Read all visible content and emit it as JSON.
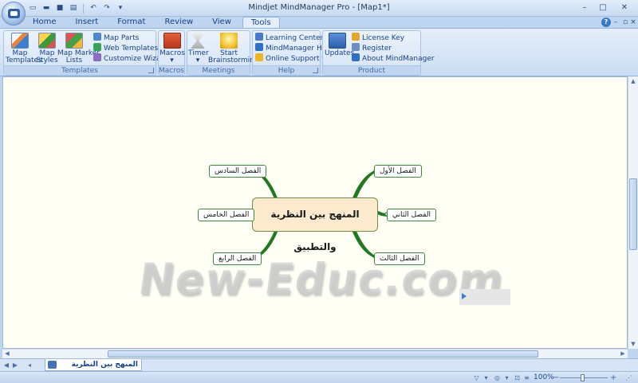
{
  "window": {
    "title": "Mindjet MindManager Pro - [Map1*]",
    "minimize": "–",
    "maximize": "□",
    "close": "✕"
  },
  "quick_access": [
    "new",
    "open",
    "save",
    "print",
    "undo",
    "redo"
  ],
  "tabs": [
    "Home",
    "Insert",
    "Format",
    "Review",
    "View",
    "Tools"
  ],
  "active_tab": "Tools",
  "ribbon": {
    "templates": {
      "label": "Templates",
      "map_templates": "Map\nTemplates",
      "map_styles": "Map\nStyles",
      "map_marker_lists": "Map Marker\nLists",
      "map_parts": "Map Parts",
      "web_templates": "Web Templates",
      "customize_wizard": "Customize Wizard"
    },
    "macros": {
      "label": "Macros",
      "macros_btn": "Macros",
      "macros_arrow": "▾"
    },
    "meetings": {
      "label": "Meetings",
      "timer": "Timer",
      "timer_arrow": "▾",
      "start_brainstorming": "Start\nBrainstorming"
    },
    "help": {
      "label": "Help",
      "learning_center": "Learning Center",
      "mindmanager_help": "MindManager Help",
      "online_support": "Online Support  ▾"
    },
    "product": {
      "label": "Product",
      "updates": "Updates",
      "license_key": "License Key",
      "register": "Register",
      "about": "About MindManager"
    }
  },
  "map": {
    "central_topic": "المنهج بين النظرية والتطبيق",
    "topics": {
      "ch1": "الفصل الأول",
      "ch2": "الفصل الثاني",
      "ch3": "الفصل الثالث",
      "ch4": "الفصل الرابع",
      "ch5": "الفصل الخامس",
      "ch6": "الفصل السادس"
    },
    "branch_color": "#1f7a1f",
    "background": "#fffff6"
  },
  "watermark": "New-Educ.com",
  "doc_tab": {
    "label": "المنهج بين النظرية والتطبيق*"
  },
  "status": {
    "zoom": "100%",
    "zoom_minus": "−",
    "zoom_plus": "+"
  }
}
